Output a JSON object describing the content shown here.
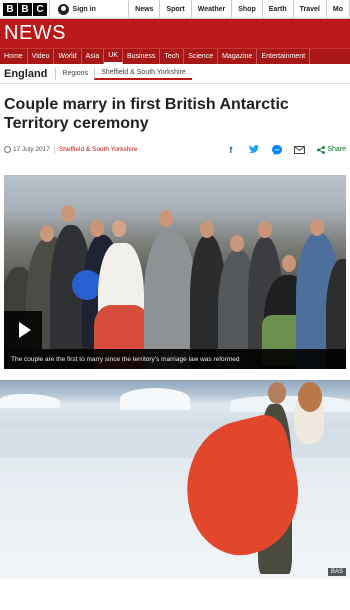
{
  "topbar": {
    "logo_letters": [
      "B",
      "B",
      "C"
    ],
    "signin": "Sign in",
    "nav": [
      "News",
      "Sport",
      "Weather",
      "Shop",
      "Earth",
      "Travel",
      "Mo"
    ]
  },
  "brand": {
    "title": "NEWS"
  },
  "section_nav": [
    "Home",
    "Video",
    "World",
    "Asia",
    "UK",
    "Business",
    "Tech",
    "Science",
    "Magazine",
    "Entertainment"
  ],
  "region": {
    "title": "England",
    "items": [
      "Regions",
      "Sheffield & South Yorkshire"
    ]
  },
  "article": {
    "headline": "Couple marry in first British Antarctic Territory ceremony",
    "date": "17 July 2017",
    "region_link": "Sheffield & South Yorkshire",
    "share_label": "Share"
  },
  "video": {
    "caption": "The couple are the first to marry since the territory's marriage law was reformed"
  },
  "photo": {
    "credit": "BAS"
  },
  "colors": {
    "brand_red": "#bb1919",
    "share_green": "#0a7a2b"
  },
  "icons": [
    "user-icon",
    "clock-icon",
    "facebook-icon",
    "twitter-icon",
    "messenger-icon",
    "email-icon",
    "share-icon",
    "play-icon"
  ]
}
